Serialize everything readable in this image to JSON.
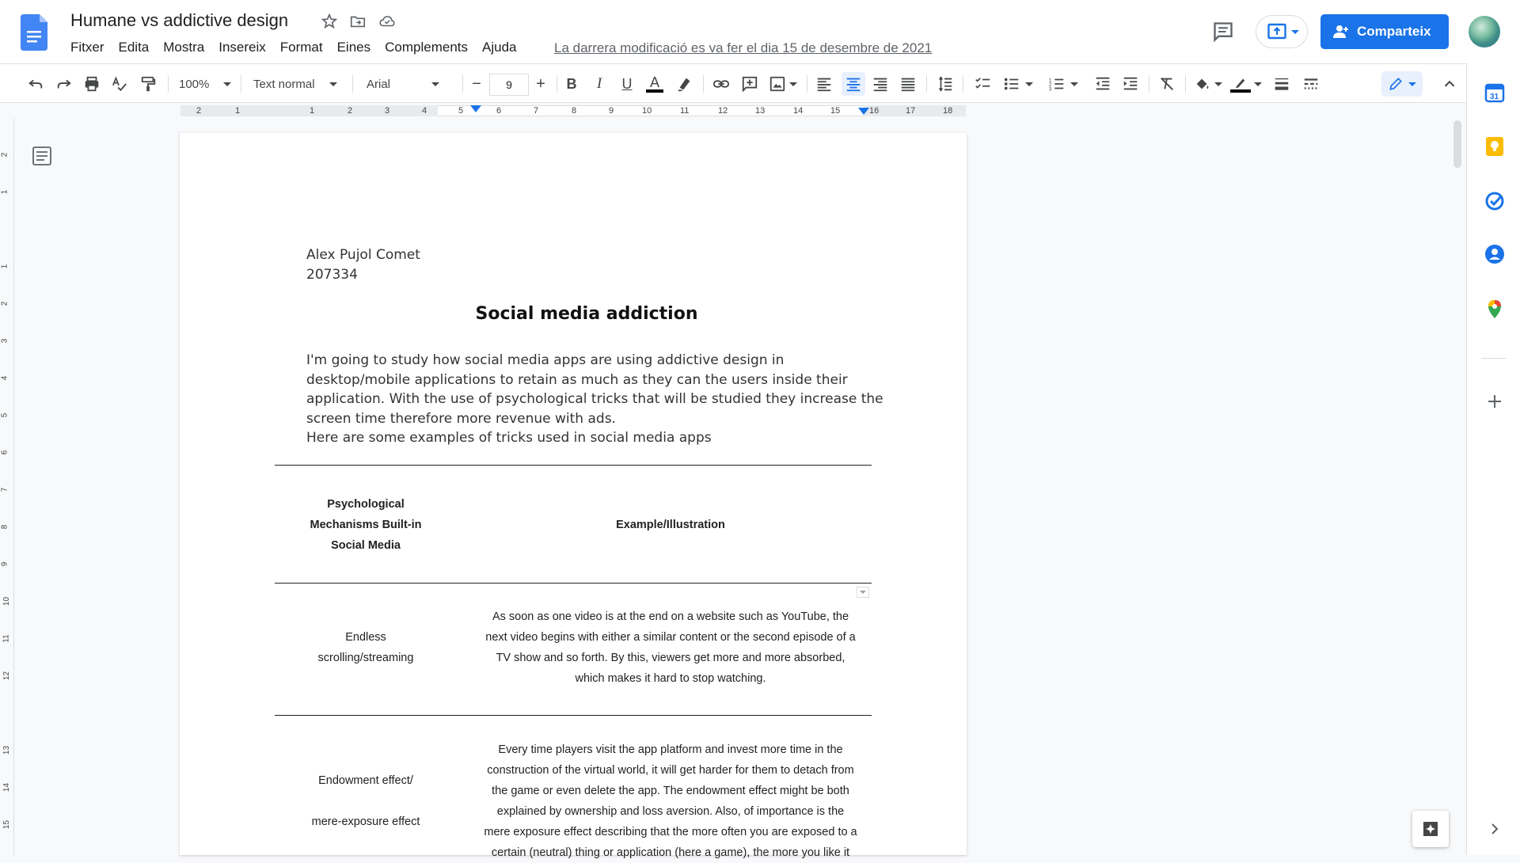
{
  "app": {
    "doc_title": "Humane vs addictive design",
    "menu": [
      "Fitxer",
      "Edita",
      "Mostra",
      "Insereix",
      "Format",
      "Eines",
      "Complements",
      "Ajuda"
    ],
    "last_edit": "La darrera modificació es va fer el dia 15 de desembre de 2021",
    "share_label": "Comparteix",
    "accent_color": "#1a73e8"
  },
  "toolbar": {
    "zoom": "100%",
    "style": "Text normal",
    "font": "Arial",
    "font_size": "9"
  },
  "ruler": {
    "numbers": [
      "2",
      "1",
      "1",
      "2",
      "3",
      "4",
      "5",
      "6",
      "7",
      "8",
      "9",
      "10",
      "11",
      "12",
      "13",
      "14",
      "15",
      "16",
      "17",
      "18"
    ]
  },
  "vruler": {
    "numbers": [
      "2",
      "1",
      "1",
      "2",
      "3",
      "4",
      "5",
      "6",
      "7",
      "8",
      "9",
      "10",
      "11",
      "12",
      "13",
      "14",
      "15",
      "16"
    ]
  },
  "document": {
    "author": "Alex Pujol Comet",
    "student_id": "207334",
    "heading": "Social media addiction",
    "intro_lines": [
      "I'm going to study how social media apps are using addictive design in",
      "desktop/mobile applications to retain as much as they can the users inside their",
      "application. With the use of psychological tricks that will be studied they increase the",
      "screen time therefore more revenue with ads.",
      "Here are some examples of tricks used in social media apps"
    ],
    "table": {
      "header_col1": [
        "Psychological",
        "Mechanisms Built-in",
        "Social Media"
      ],
      "header_col2": "Example/Illustration",
      "rows": [
        {
          "mechanism": [
            "Endless",
            "scrolling/streaming"
          ],
          "example": [
            "As soon as one video is at the end on a website such as YouTube, the",
            "next video begins with either a similar content or the second episode of a",
            "TV show and so forth. By this, viewers get more and more absorbed,",
            "which makes it hard to stop watching."
          ]
        },
        {
          "mechanism": [
            "Endowment effect/",
            "",
            "mere-exposure effect"
          ],
          "example": [
            "Every time players visit the app platform and invest more time in the",
            "construction of the virtual world, it will get harder for them to detach from",
            "the game or even delete the app. The endowment effect might be both",
            "explained by ownership and loss aversion. Also, of importance is the",
            "mere exposure effect describing that the more often you are exposed to a",
            "certain (neutral) thing or application (here a game), the more you like it"
          ]
        }
      ]
    }
  }
}
